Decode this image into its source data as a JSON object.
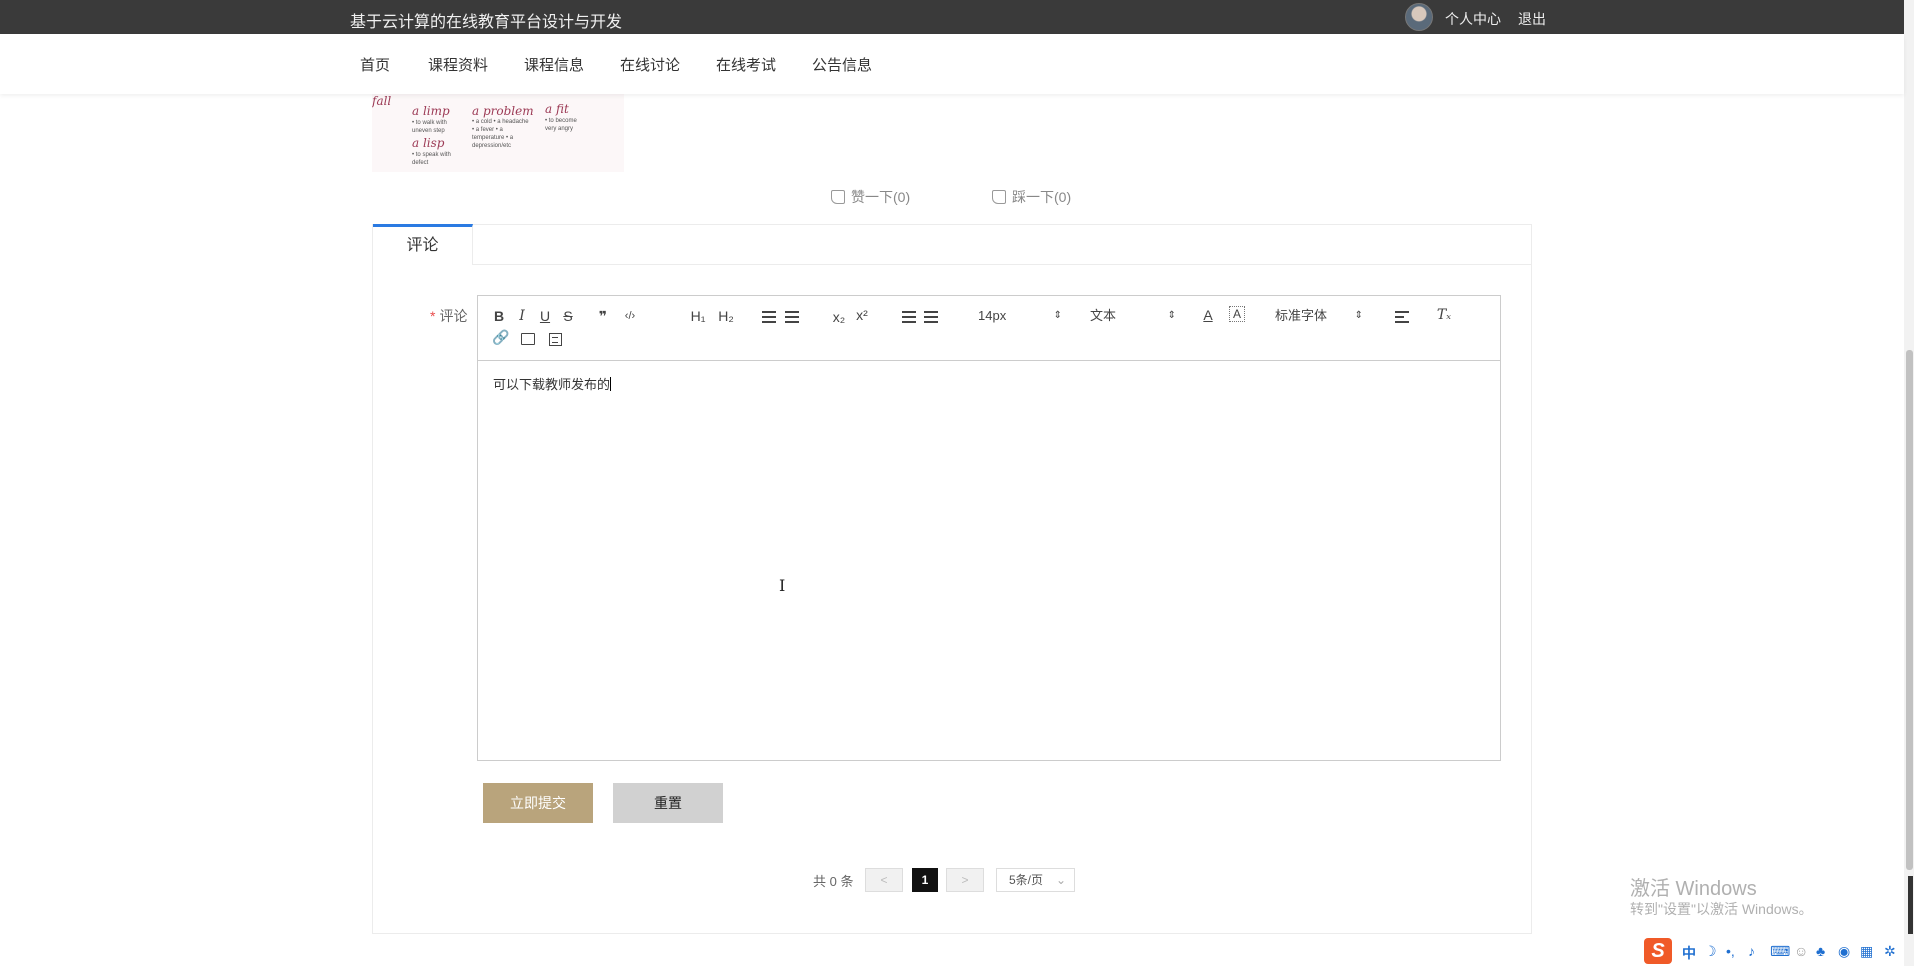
{
  "header": {
    "site_title": "基于云计算的在线教育平台设计与开发",
    "user_center": "个人中心",
    "logout": "退出"
  },
  "nav": {
    "items": [
      "首页",
      "课程资料",
      "课程信息",
      "在线讨论",
      "在线考试",
      "公告信息"
    ]
  },
  "article_image": {
    "words": [
      "fall",
      "a limp",
      "a problem",
      "a fit",
      "a lisp"
    ],
    "notes": {
      "limp": "• to walk with uneven step",
      "lisp": "• to speak with defect",
      "problem": "• a cold • a headache • a fever • a temperature • a depression/etc",
      "fit": "• to become very angry"
    }
  },
  "votes": {
    "like": "赞一下(0)",
    "dislike": "踩一下(0)"
  },
  "comment_panel": {
    "tab_label": "评论",
    "field_label": "评论",
    "required_mark": "*",
    "toolbar": {
      "bold": "B",
      "italic": "I",
      "underline": "U",
      "strike": "S",
      "quote": "❞",
      "code": "‹/›",
      "h1": "H₁",
      "h2": "H₂",
      "subscript": "x₂",
      "superscript": "x²",
      "font_size": "14px",
      "text_style": "文本",
      "font_family": "标准字体",
      "clear_format": "Tₓ"
    },
    "content": "可以下载教师发布的",
    "submit_label": "立即提交",
    "reset_label": "重置"
  },
  "pagination": {
    "total": "共 0 条",
    "prev": "<",
    "current": "1",
    "next": ">",
    "page_size": "5条/页"
  },
  "watermark": {
    "line1": "激活 Windows",
    "line2": "转到\"设置\"以激活 Windows。"
  },
  "ime": {
    "lang": "中",
    "logo": "S"
  },
  "colors": {
    "topbar": "#3a3a3a",
    "tab_accent": "#2a7ae2",
    "submit_button": "#b9a47c",
    "reset_button": "#d1d1d1",
    "required": "#e94b4b"
  }
}
